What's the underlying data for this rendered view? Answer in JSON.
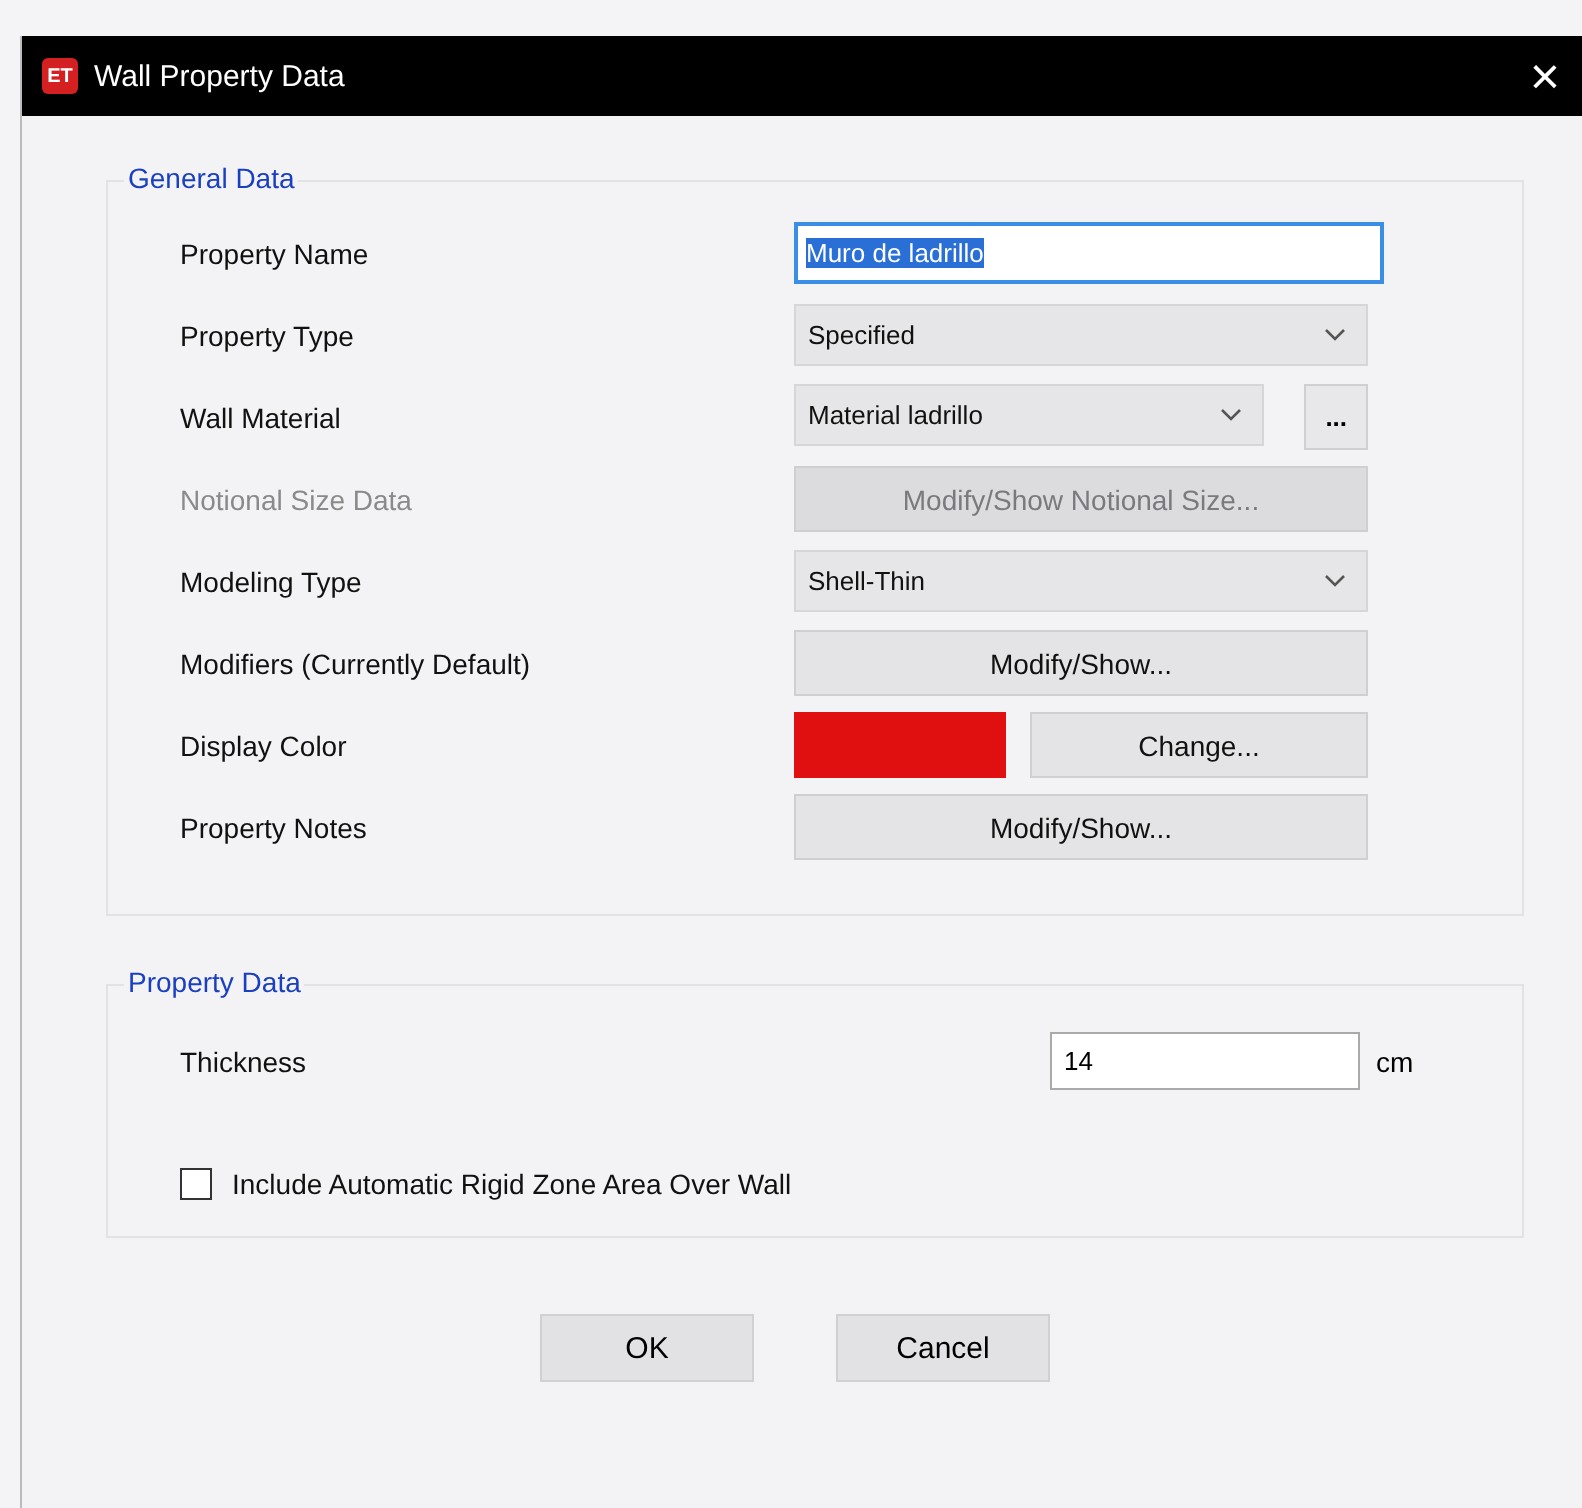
{
  "window": {
    "icon_text": "ET",
    "title": "Wall Property Data",
    "close": "×"
  },
  "general": {
    "title": "General Data",
    "rows": [
      {
        "kind": "text",
        "label": "Property Name",
        "value": "Muro de ladrillo",
        "text_selected": true
      },
      {
        "kind": "dropdown",
        "label": "Property Type",
        "value": "Specified"
      },
      {
        "kind": "dropdown",
        "label": "Wall Material",
        "value": "Material ladrillo",
        "extra_button": "..."
      },
      {
        "kind": "button",
        "label": "Notional Size Data",
        "button": "Modify/Show Notional Size...",
        "disabled": true
      },
      {
        "kind": "dropdown",
        "label": "Modeling Type",
        "value": "Shell-Thin"
      },
      {
        "kind": "button",
        "label": "Modifiers (Currently Default)",
        "button": "Modify/Show...",
        "disabled": false
      },
      {
        "kind": "color",
        "label": "Display Color",
        "color": "#e01010",
        "button": "Change..."
      },
      {
        "kind": "button",
        "label": "Property Notes",
        "button": "Modify/Show...",
        "disabled": false
      }
    ]
  },
  "property": {
    "title": "Property Data",
    "thickness": {
      "label": "Thickness",
      "value": "14",
      "unit": "cm"
    },
    "rigid_zone": {
      "label": "Include Automatic Rigid Zone Area Over Wall",
      "checked": false
    }
  },
  "buttons": [
    "OK",
    "Cancel"
  ]
}
